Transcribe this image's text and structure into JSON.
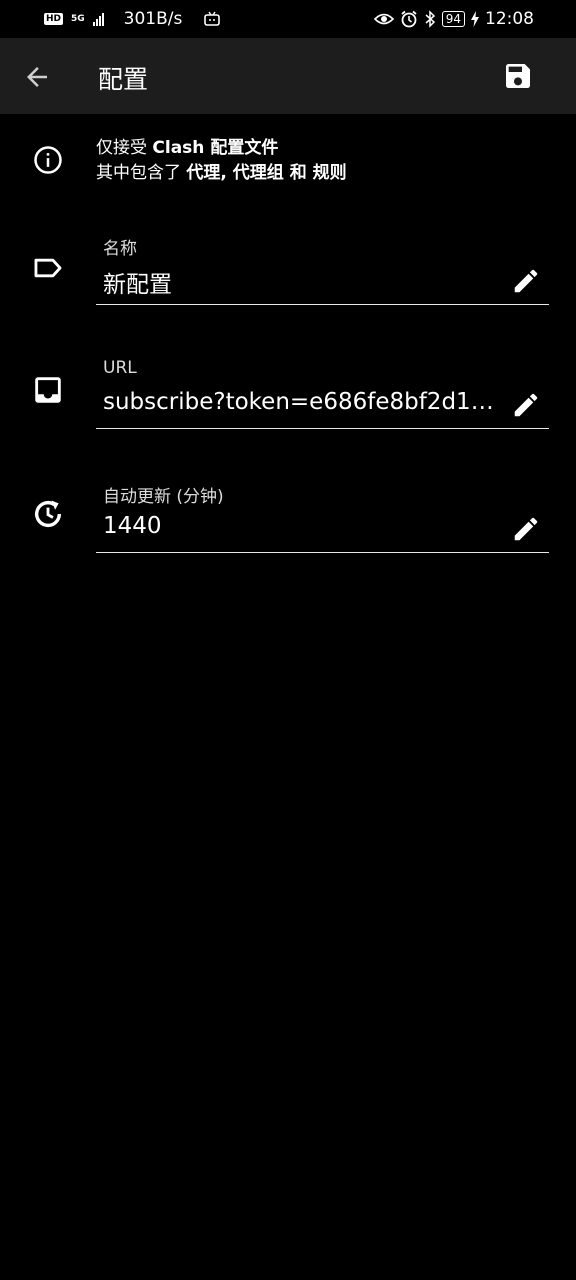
{
  "status_bar": {
    "network_badge": "HD",
    "network_type": "5G",
    "net_speed": "301B/s",
    "battery_level": "94",
    "time": "12:08"
  },
  "app_bar": {
    "title": "配置"
  },
  "info": {
    "line1_prefix": "仅接受 ",
    "line1_bold": "Clash 配置文件",
    "line2_prefix": "其中包含了 ",
    "line2_bold": "代理, 代理组 和 规则"
  },
  "fields": [
    {
      "label": "名称",
      "value": "新配置",
      "icon": "label-tag-icon"
    },
    {
      "label": "URL",
      "value": "subscribe?token=e686fe8bf2d12b...",
      "icon": "inbox-icon"
    },
    {
      "label": "自动更新 (分钟)",
      "value": "1440",
      "icon": "clock-update-icon"
    }
  ],
  "colors": {
    "background": "#000000",
    "app_bar": "#1d1d1d",
    "text": "#ffffff",
    "underline": "#e8e8e8"
  }
}
